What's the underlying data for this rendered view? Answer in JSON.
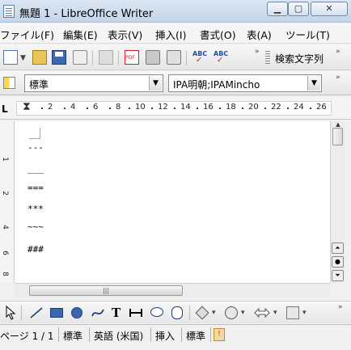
{
  "window": {
    "title": "無題 1 - LibreOffice Writer",
    "min_glyph": "▁",
    "max_glyph": "▢",
    "close_glyph": "✕"
  },
  "menu": [
    {
      "label": "ファイル(F)"
    },
    {
      "label": "編集(E)"
    },
    {
      "label": "表示(V)"
    },
    {
      "label": "挿入(I)"
    },
    {
      "label": "書式(O)"
    },
    {
      "label": "表(A)"
    },
    {
      "label": "ツール(T)"
    }
  ],
  "toolbar1": {
    "find_label": "検索文字列",
    "abc_text": "ABC",
    "overflow_glyph": "»"
  },
  "formatting": {
    "paragraph_style": "標準",
    "font_name": "IPA明朝;IPAMincho",
    "dropdown_glyph": "▼"
  },
  "ruler": {
    "tab_glyph": "L",
    "indent_glyph": "⧗",
    "numbers": [
      "2",
      "4",
      "6",
      "8",
      "10",
      "12",
      "14",
      "16",
      "18",
      "20",
      "22",
      "24",
      "26"
    ],
    "vertical_numbers": [
      "1",
      "2",
      "4",
      "6",
      "8"
    ]
  },
  "document": {
    "lines": [
      "---",
      "___",
      "===",
      "***",
      "~~~",
      "###"
    ]
  },
  "scroll": {
    "up_glyph": "▲",
    "nav_prev_glyph": "⏶",
    "nav_mid_glyph": "●",
    "nav_next_glyph": "⏷",
    "hthumb_grip": "|||"
  },
  "drawbar": {
    "text_tool": "T",
    "arrow_glyph": "▾"
  },
  "status": {
    "page": "ページ 1 / 1",
    "style": "標準",
    "language": "英語 (米国)",
    "mode": "挿入",
    "selection": "標準",
    "save_glyph": "!"
  }
}
